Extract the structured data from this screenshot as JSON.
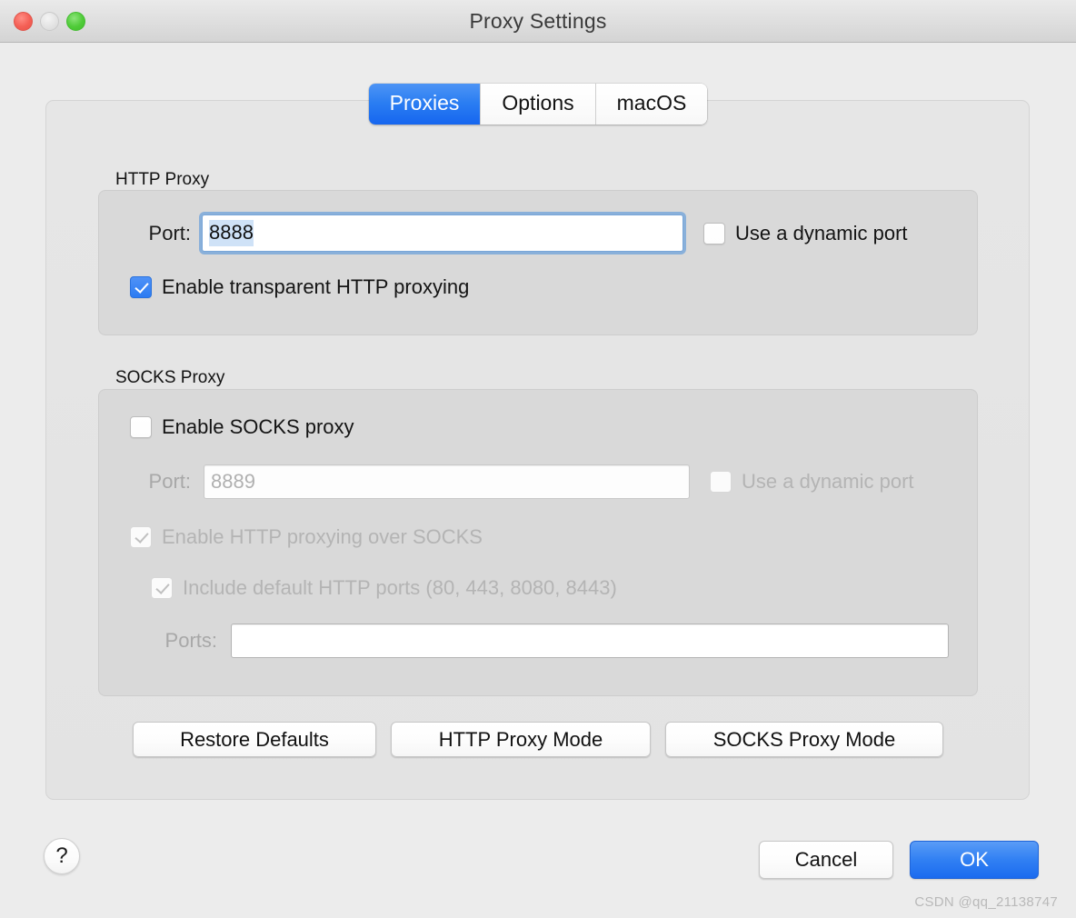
{
  "window": {
    "title": "Proxy Settings",
    "controls": {
      "close": "close-button",
      "minimize": "minimize-button",
      "zoom": "zoom-button"
    }
  },
  "tabs": [
    {
      "label": "Proxies",
      "active": true
    },
    {
      "label": "Options",
      "active": false
    },
    {
      "label": "macOS",
      "active": false
    }
  ],
  "http_proxy": {
    "group_label": "HTTP Proxy",
    "port_label": "Port:",
    "port_value": "8888",
    "port_focused": true,
    "dynamic_port_label": "Use a dynamic port",
    "dynamic_port_checked": false,
    "transparent_label": "Enable transparent HTTP proxying",
    "transparent_checked": true
  },
  "socks_proxy": {
    "group_label": "SOCKS Proxy",
    "enable_label": "Enable SOCKS proxy",
    "enable_checked": false,
    "port_label": "Port:",
    "port_value": "8889",
    "dynamic_port_label": "Use a dynamic port",
    "dynamic_port_checked": false,
    "http_over_socks_label": "Enable HTTP proxying over SOCKS",
    "http_over_socks_checked": true,
    "default_ports_label": "Include default HTTP ports (80, 443, 8080, 8443)",
    "default_ports_checked": true,
    "ports_label": "Ports:",
    "ports_value": ""
  },
  "mode_buttons": {
    "restore_defaults": "Restore Defaults",
    "http_proxy_mode": "HTTP Proxy Mode",
    "socks_proxy_mode": "SOCKS Proxy Mode"
  },
  "footer": {
    "help": "?",
    "cancel": "Cancel",
    "ok": "OK",
    "watermark": "CSDN @qq_21138747"
  },
  "colors": {
    "accent_blue": "#2b7bf2",
    "window_bg": "#ececec",
    "panel_bg": "#e4e4e4",
    "group_bg": "#d9d9d9",
    "selection_blue": "#cfe2f7",
    "disabled_text": "#b4b4b4"
  }
}
